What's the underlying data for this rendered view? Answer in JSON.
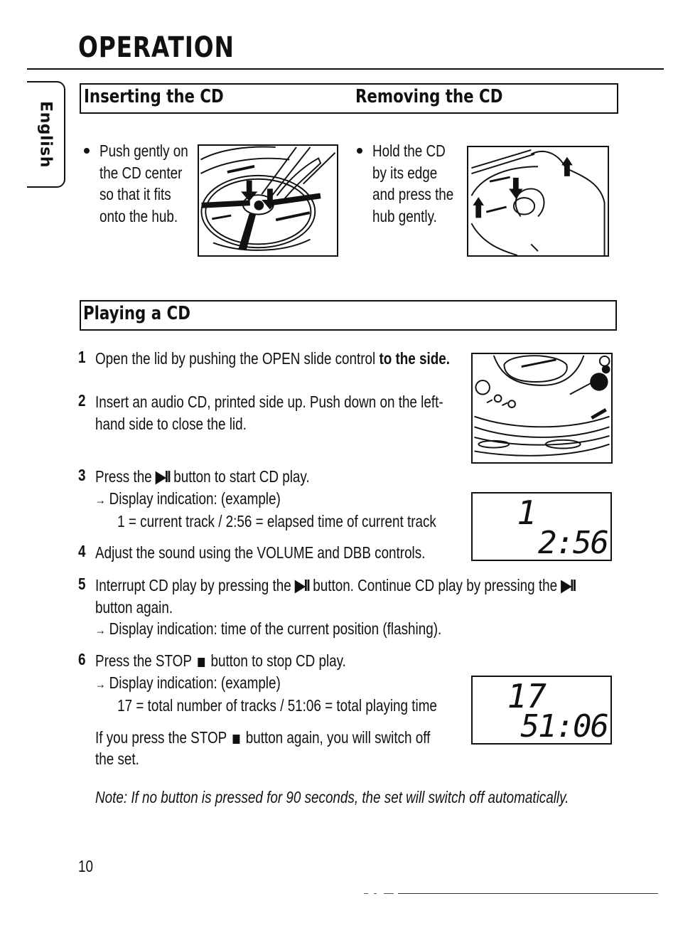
{
  "page": {
    "title": "OPERATION",
    "language_tab": "English",
    "page_number": "10"
  },
  "inserting": {
    "heading": "Inserting the CD",
    "lines": [
      "Push gently on",
      "the CD center",
      "so that it fits",
      "onto the hub."
    ],
    "illustration": "finger pressing CD onto hub with down arrows"
  },
  "removing": {
    "heading": "Removing the CD",
    "lines": [
      "Hold the CD",
      "by its edge",
      "and press the",
      "hub gently."
    ],
    "illustration": "hand lifting CD by edge while pressing hub"
  },
  "playing": {
    "heading": "Playing a CD",
    "steps": [
      {
        "num": "1",
        "text_plain": "Open the lid by pushing the OPEN slide control ",
        "text_bold": "to the side."
      },
      {
        "num": "2",
        "lines": [
          "Insert an audio CD, printed side up. Push down on the left-",
          "hand side to close the lid."
        ]
      },
      {
        "num": "3",
        "text_pre": "Press the ",
        "symbol": "▶II",
        "text_post": " button to start CD play.",
        "result_arrow": "→",
        "result": "Display indication: (example)",
        "explanation": "1 = current track / 2:56 = elapsed time of current track"
      },
      {
        "num": "4",
        "text": "Adjust the sound using the VOLUME and DBB controls."
      },
      {
        "num": "5",
        "text_pre": "Interrupt CD play by pressing the ",
        "symbol": "▶II",
        "text_mid": " button. Continue CD play by pressing the ",
        "line2": "button again.",
        "result_arrow": "→",
        "result": "Display indication: time of the current position (flashing)."
      },
      {
        "num": "6",
        "text_pre": "Press the STOP ",
        "text_post": " button to stop CD play.",
        "result_arrow": "→",
        "result": "Display indication: (example)",
        "explanation": "17 = total number of tracks / 51:06 = total playing time",
        "extra_pre": "If you press the STOP ",
        "extra_post": " button again, you will switch off",
        "extra_line2": "the set."
      }
    ],
    "display_play": {
      "track": "1",
      "time": "2:56"
    },
    "display_stop": {
      "track": "17",
      "time": "51:06"
    },
    "illustration": "CD player top view with OPEN slide control"
  },
  "note": "Note: If no button is pressed for 90 seconds, the set will switch off automatically."
}
